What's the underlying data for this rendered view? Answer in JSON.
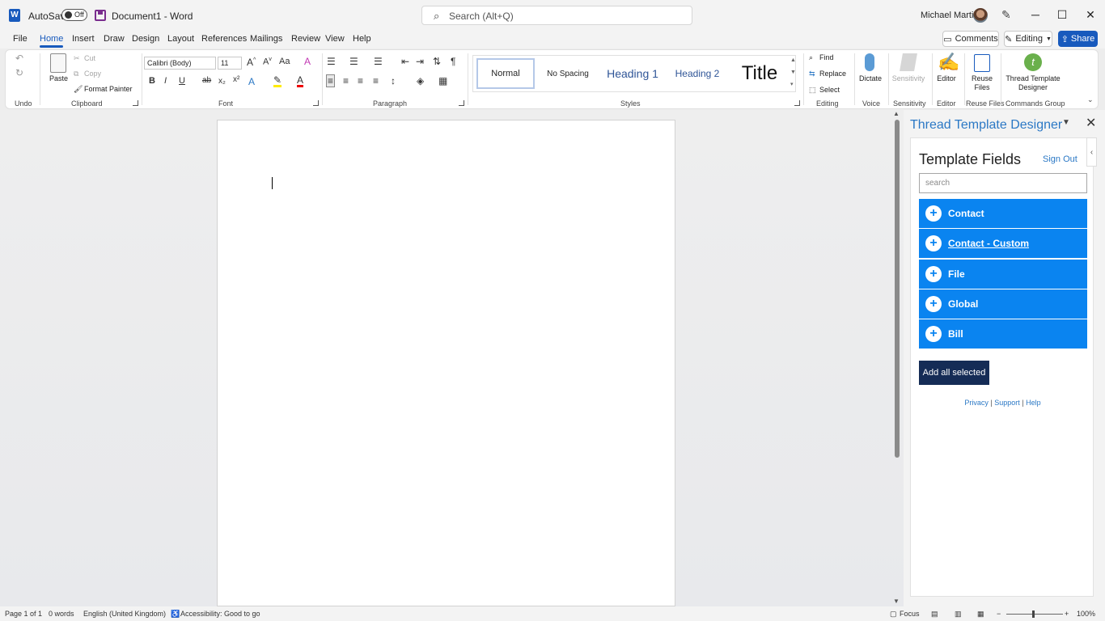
{
  "app": {
    "autosave_label": "AutoSave",
    "autosave_state": "Off",
    "doc_title": "Document1  -  Word",
    "search_placeholder": "Search (Alt+Q)",
    "user_name": "Michael Martin"
  },
  "tabs": [
    "File",
    "Home",
    "Insert",
    "Draw",
    "Design",
    "Layout",
    "References",
    "Mailings",
    "Review",
    "View",
    "Help"
  ],
  "active_tab": "Home",
  "header_buttons": {
    "comments": "Comments",
    "editing": "Editing",
    "share": "Share"
  },
  "ribbon": {
    "groups": {
      "undo": "Undo",
      "clipboard": "Clipboard",
      "font": "Font",
      "paragraph": "Paragraph",
      "styles": "Styles",
      "editing": "Editing",
      "voice": "Voice",
      "sensitivity": "Sensitivity",
      "editor": "Editor",
      "reuse_files": "Reuse Files",
      "commands_group": "Commands Group"
    },
    "clipboard": {
      "paste": "Paste",
      "cut": "Cut",
      "copy": "Copy",
      "format_painter": "Format Painter"
    },
    "font": {
      "family": "Calibri (Body)",
      "size": "11"
    },
    "styles": [
      "Normal",
      "No Spacing",
      "Heading 1",
      "Heading 2",
      "Title"
    ],
    "editing": {
      "find": "Find",
      "replace": "Replace",
      "select": "Select"
    },
    "dictate": "Dictate",
    "sensitivity": "Sensitivity",
    "editor": "Editor",
    "reuse_files": "Reuse Files",
    "thread_template_designer": "Thread Template Designer"
  },
  "pane": {
    "title": "Thread Template Designer",
    "heading": "Template Fields",
    "sign_out": "Sign Out",
    "search_placeholder": "search",
    "fields": [
      {
        "label": "Contact",
        "link": false
      },
      {
        "label": "Contact - Custom",
        "link": true
      },
      {
        "label": "File",
        "link": false
      },
      {
        "label": "Global",
        "link": false
      },
      {
        "label": "Bill",
        "link": false
      }
    ],
    "add_all": "Add all selected",
    "links": {
      "privacy": "Privacy",
      "support": "Support",
      "help": "Help",
      "separator": "|"
    }
  },
  "status": {
    "page": "Page 1 of 1",
    "words": "0 words",
    "language": "English (United Kingdom)",
    "accessibility": "Accessibility: Good to go",
    "focus": "Focus",
    "zoom": "100%"
  },
  "colors": {
    "brand_blue": "#185abd",
    "field_blue": "#0a84f0",
    "add_all_navy": "#152c56",
    "link_blue": "#2b78c5"
  }
}
